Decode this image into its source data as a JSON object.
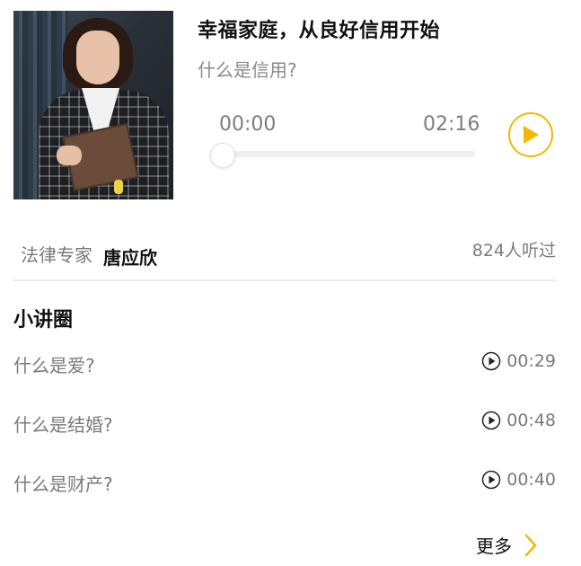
{
  "player": {
    "title": "幸福家庭，从良好信用开始",
    "subtitle": "什么是信用?",
    "current_time": "00:00",
    "duration": "02:16",
    "progress": 0,
    "play_icon": "play-icon"
  },
  "speaker": {
    "role": "法律专家",
    "name": "唐应欣",
    "listen_count": "824人听过"
  },
  "section": {
    "title": "小讲圈"
  },
  "tracks": [
    {
      "title": "什么是爱?",
      "duration": "00:29"
    },
    {
      "title": "什么是结婚?",
      "duration": "00:48"
    },
    {
      "title": "什么是财产?",
      "duration": "00:40"
    }
  ],
  "more": {
    "label": "更多",
    "icon": "chevron-right-icon"
  },
  "colors": {
    "accent": "#f5b800",
    "muted_text": "#7a7a7a",
    "divider": "#ededed"
  }
}
